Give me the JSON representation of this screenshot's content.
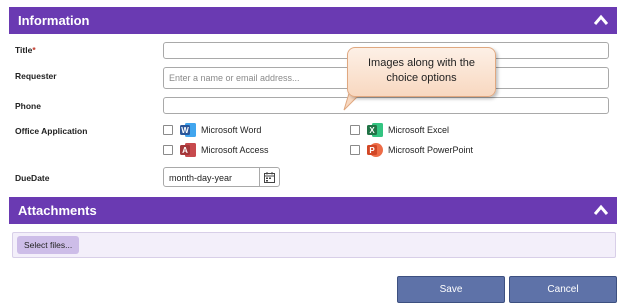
{
  "information": {
    "title": "Information",
    "fields": {
      "title_label": "Title",
      "title_required": "*",
      "requester_label": "Requester",
      "requester_placeholder": "Enter a name or email address...",
      "phone_label": "Phone",
      "office_label": "Office Application",
      "duedate_label": "DueDate",
      "duedate_value": "month-day-year"
    },
    "choices": [
      {
        "label": "Microsoft Word",
        "icon": "word-icon",
        "letter": "W",
        "color": "#2b579a"
      },
      {
        "label": "Microsoft Excel",
        "icon": "excel-icon",
        "letter": "X",
        "color": "#217346"
      },
      {
        "label": "Microsoft Access",
        "icon": "access-icon",
        "letter": "A",
        "color": "#a4373a"
      },
      {
        "label": "Microsoft PowerPoint",
        "icon": "powerpoint-icon",
        "letter": "P",
        "color": "#d24726"
      }
    ]
  },
  "callout": {
    "line1": "Images along with the",
    "line2": "choice options"
  },
  "attachments": {
    "title": "Attachments",
    "select_label": "Select files..."
  },
  "actions": {
    "save_label": "Save",
    "cancel_label": "Cancel"
  },
  "colors": {
    "header": "#6a3ab2",
    "button": "#5e72a8"
  }
}
